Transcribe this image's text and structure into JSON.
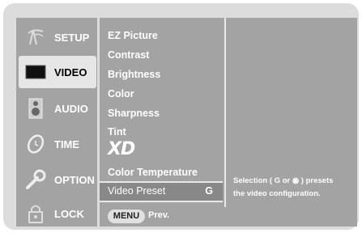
{
  "sidebar": {
    "items": [
      {
        "label": "SETUP",
        "icon": "antenna-icon"
      },
      {
        "label": "VIDEO",
        "icon": "tv-screen-icon"
      },
      {
        "label": "AUDIO",
        "icon": "speaker-icon"
      },
      {
        "label": "TIME",
        "icon": "clock-icon"
      },
      {
        "label": "OPTION",
        "icon": "wrench-icon"
      },
      {
        "label": "LOCK",
        "icon": "padlock-icon"
      }
    ],
    "selected": "VIDEO"
  },
  "menu": {
    "items": [
      "EZ Picture",
      "Contrast",
      "Brightness",
      "Color",
      "Sharpness",
      "Tint",
      "XD",
      "Color Temperature"
    ],
    "selected_item": "Video Preset",
    "selected_arrow": "G"
  },
  "footer": {
    "menu_button": "MENU",
    "prev_label": "Prev."
  },
  "help": {
    "line1_prefix": "Selection (",
    "line1_key1": "G",
    "line1_or": " or ",
    "line1_key2": "◉",
    "line1_suffix": ") presets",
    "line2": "the video configuration."
  },
  "colors": {
    "panel": "#a3a3a3",
    "frame": "#dcdcdc",
    "selected_bg": "#888888"
  }
}
